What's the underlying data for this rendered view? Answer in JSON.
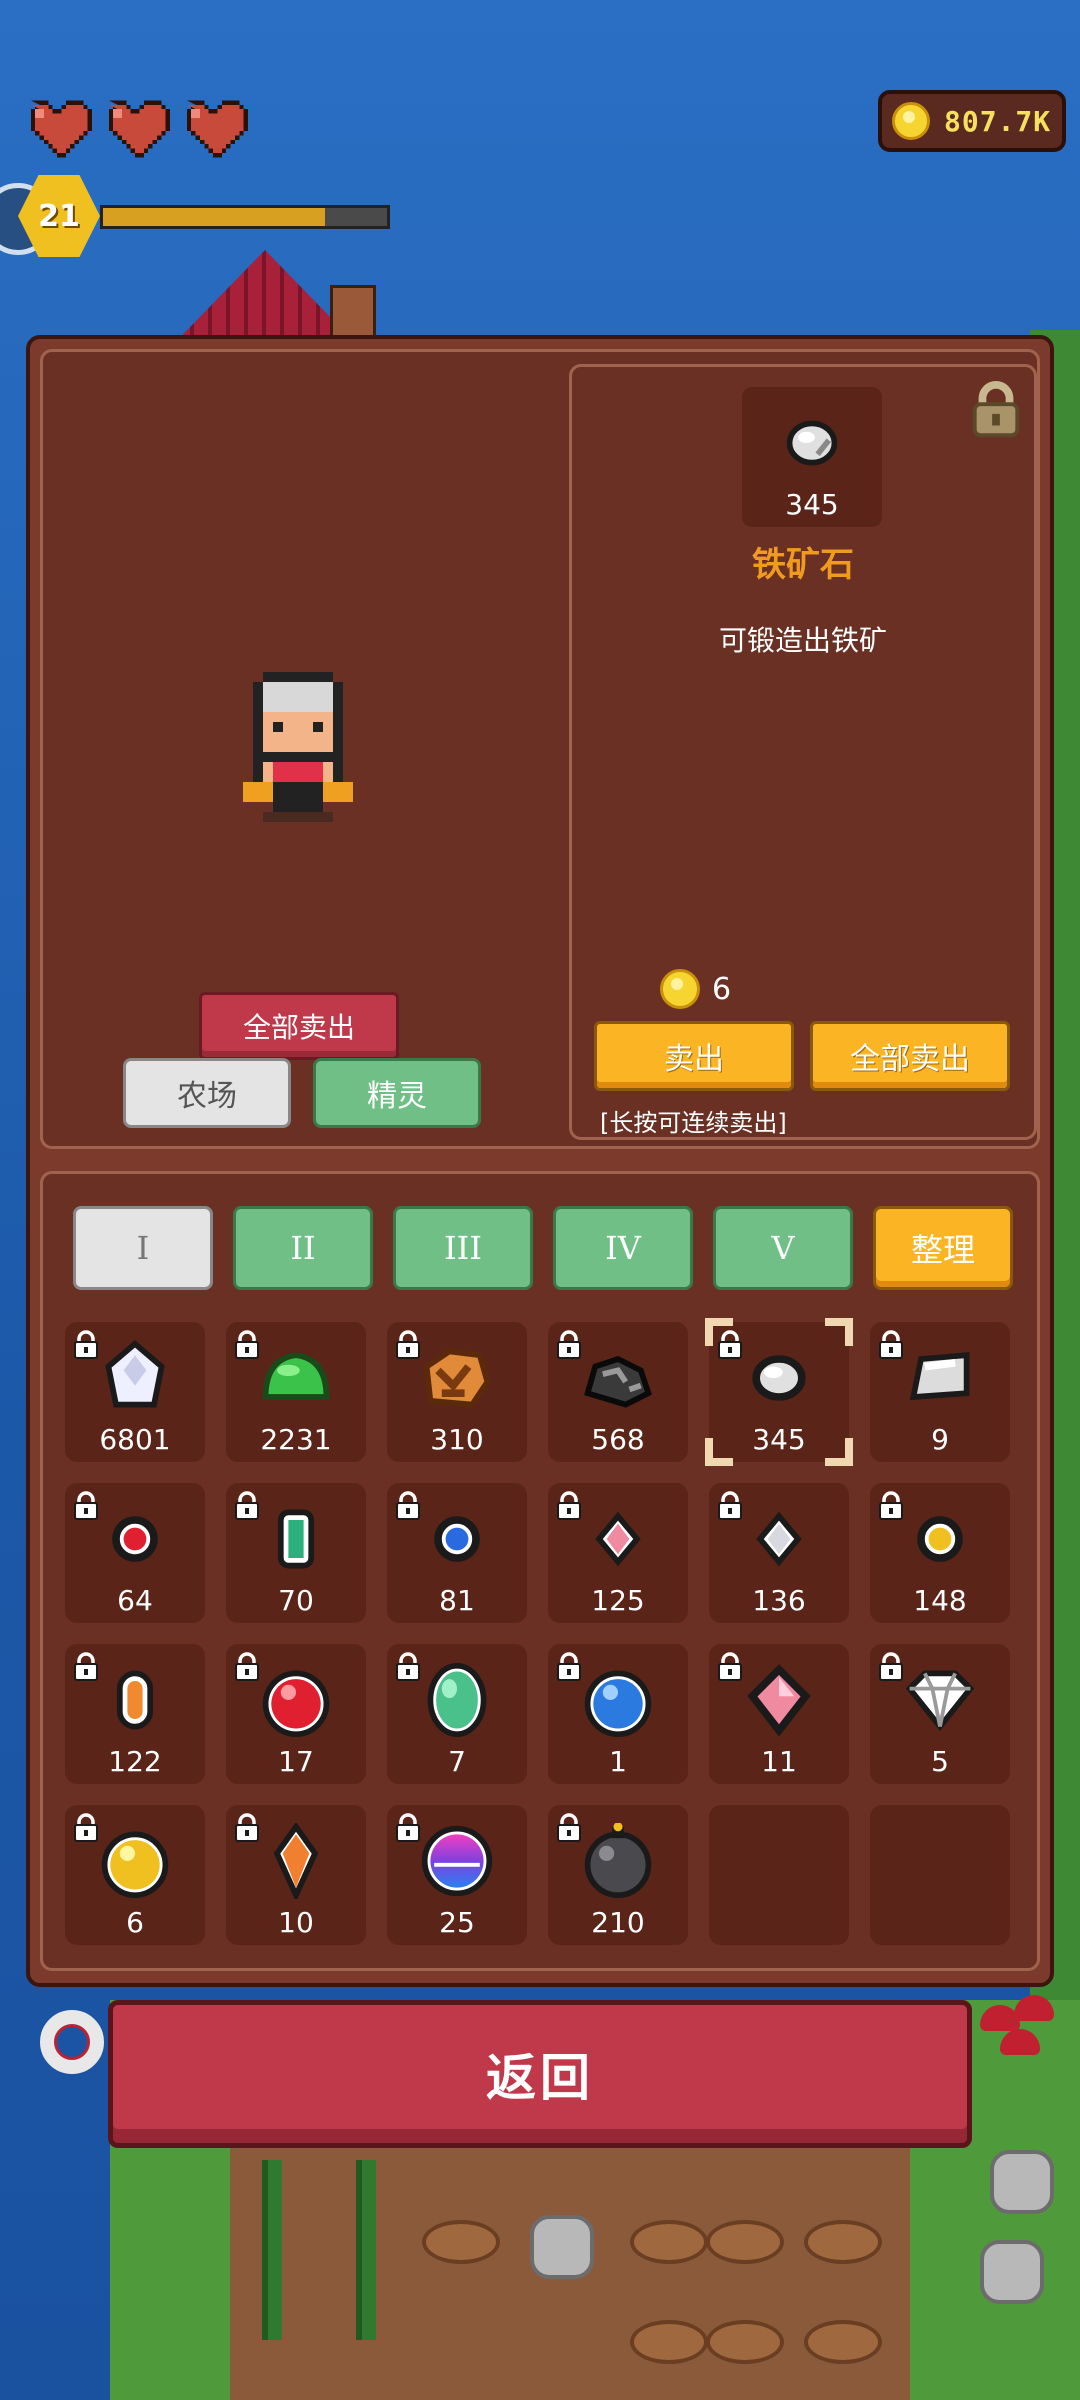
{
  "hud": {
    "hearts": 3,
    "level": "21",
    "xp_progress": 0.78,
    "coins": "807.7K"
  },
  "character_panel": {
    "sell_all_label": "全部卖出",
    "tabs": [
      {
        "label": "农场",
        "active": true
      },
      {
        "label": "精灵",
        "active": false
      }
    ]
  },
  "detail": {
    "icon": "iron-ore-icon",
    "count": "345",
    "name": "铁矿石",
    "description": "可锻造出铁矿",
    "price": "6",
    "sell_label": "卖出",
    "sell_all_label": "全部卖出",
    "hint": "[长按可连续卖出]"
  },
  "categories": [
    {
      "label": "I",
      "active": true
    },
    {
      "label": "II",
      "active": false
    },
    {
      "label": "III",
      "active": false
    },
    {
      "label": "IV",
      "active": false
    },
    {
      "label": "V",
      "active": false
    }
  ],
  "sort_label": "整理",
  "inventory": [
    {
      "icon": "white-crystal-icon",
      "count": "6801"
    },
    {
      "icon": "green-slime-icon",
      "count": "2231"
    },
    {
      "icon": "copper-ore-icon",
      "count": "310"
    },
    {
      "icon": "coal-icon",
      "count": "568"
    },
    {
      "icon": "iron-ore-icon",
      "count": "345",
      "selected": true
    },
    {
      "icon": "silver-ingot-icon",
      "count": "9"
    },
    {
      "icon": "red-gem-small-icon",
      "count": "64"
    },
    {
      "icon": "green-gem-small-icon",
      "count": "70"
    },
    {
      "icon": "blue-gem-small-icon",
      "count": "81"
    },
    {
      "icon": "pink-gem-small-icon",
      "count": "125"
    },
    {
      "icon": "white-gem-small-icon",
      "count": "136"
    },
    {
      "icon": "yellow-gem-small-icon",
      "count": "148"
    },
    {
      "icon": "amber-gem-icon",
      "count": "122"
    },
    {
      "icon": "ruby-icon",
      "count": "17"
    },
    {
      "icon": "emerald-icon",
      "count": "7"
    },
    {
      "icon": "sapphire-icon",
      "count": "1"
    },
    {
      "icon": "pink-diamond-icon",
      "count": "11"
    },
    {
      "icon": "diamond-icon",
      "count": "5"
    },
    {
      "icon": "topaz-icon",
      "count": "6"
    },
    {
      "icon": "orange-crystal-icon",
      "count": "10"
    },
    {
      "icon": "rainbow-orb-icon",
      "count": "25"
    },
    {
      "icon": "bomb-icon",
      "count": "210"
    },
    {
      "icon": "",
      "count": ""
    },
    {
      "icon": "",
      "count": ""
    }
  ],
  "return_label": "返回"
}
